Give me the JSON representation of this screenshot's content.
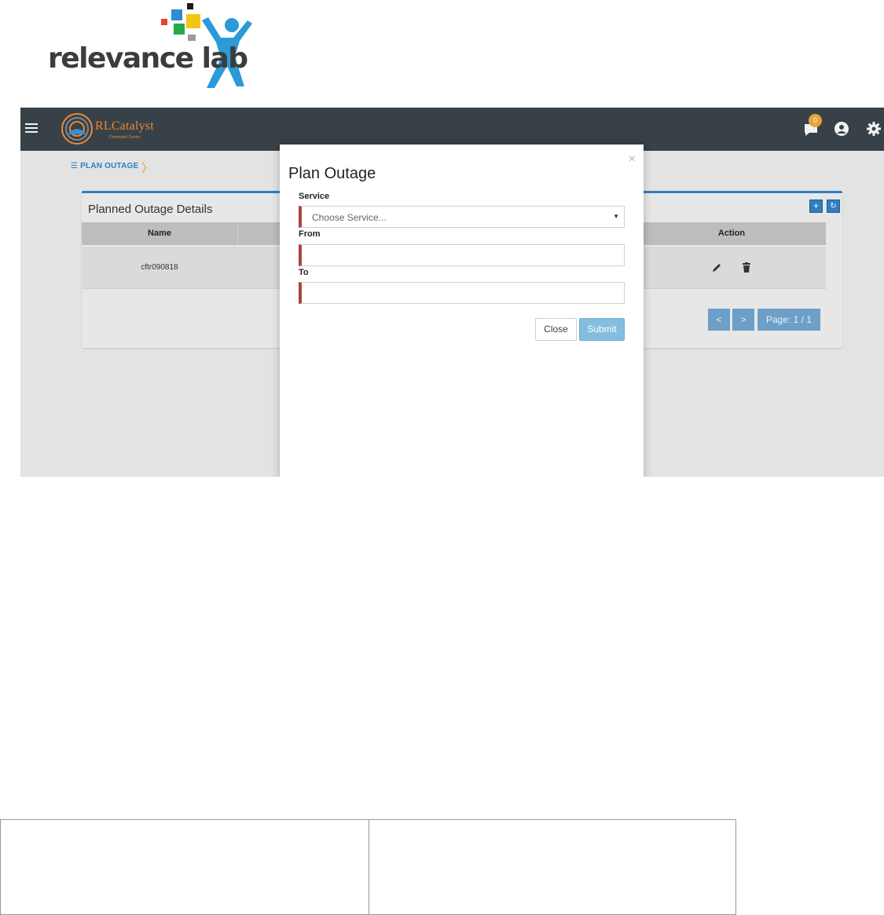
{
  "logo": {
    "text": "relevance lab",
    "colors": {
      "text": "#3c3c3c",
      "figure": "#2a9ad8",
      "squares": [
        "#1a1a1a",
        "#e6432b",
        "#2e8ccf",
        "#f6c510",
        "#29a84a",
        "#9a9a9a"
      ]
    }
  },
  "app": {
    "brand_name": "RLCatalyst",
    "brand_sub": "Command Center",
    "notification_count": "0",
    "breadcrumb": "PLAN OUTAGE",
    "colors": {
      "topbar": "#384148",
      "accent": "#2f7fc1",
      "brand": "#e98a35"
    }
  },
  "panel": {
    "title": "Planned Outage Details",
    "add_icon": "+",
    "refresh_icon": "↻",
    "columns": [
      "Name",
      "Action"
    ],
    "rows": [
      {
        "name": "cftr090818"
      }
    ],
    "pager": {
      "prev": "<",
      "next": ">",
      "page_label": "Page: 1 / 1"
    }
  },
  "modal": {
    "title": "Plan Outage",
    "close_x": "×",
    "service_label": "Service",
    "service_placeholder": "Choose Service...",
    "from_label": "From",
    "to_label": "To",
    "close_button": "Close",
    "submit_button": "Submit"
  }
}
